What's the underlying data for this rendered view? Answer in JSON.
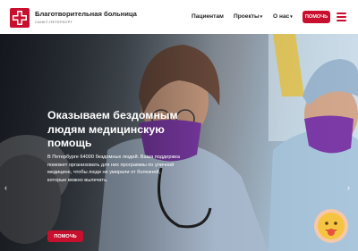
{
  "header": {
    "brand_title": "Благотворительная больница",
    "brand_subtitle": "САНКТ-ПЕТЕРБУРГ",
    "nav": [
      {
        "label": "Пациентам",
        "caret": ""
      },
      {
        "label": "Проекты",
        "caret": "▾"
      },
      {
        "label": "О нас",
        "caret": "▾"
      }
    ],
    "help_button": "ПОМОЧЬ"
  },
  "hero": {
    "title": "Оказываем бездомным людям медицинскую помощь",
    "text": "В Петербурге 64000 бездомных людей. Ваша поддержка поможет организовать для них программы по уличной медицине, чтобы люди не умирали от болезней, которые можно вылечить.",
    "button": "ПОМОЧЬ",
    "prev_arrow": "‹",
    "next_arrow": "›"
  },
  "colors": {
    "accent": "#c8102e"
  }
}
